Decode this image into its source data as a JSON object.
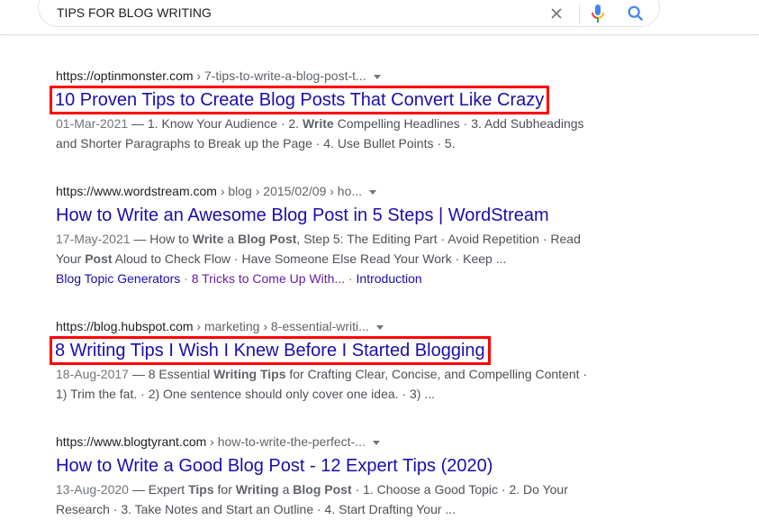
{
  "search": {
    "query": "TIPS FOR BLOG WRITING"
  },
  "icons": {
    "clear": "close-icon",
    "mic": "microphone-icon",
    "search": "search-icon"
  },
  "colors": {
    "link": "#1a0dab",
    "visited": "#681da8",
    "highlight_box": "#ff0000"
  },
  "results": [
    {
      "domain": "https://optinmonster.com",
      "crumbs": " › 7-tips-to-write-a-blog-post-t...",
      "title": "10 Proven Tips to Create Blog Posts That Convert Like Crazy",
      "highlighted": true,
      "date": "01-Mar-2021",
      "snippet": [
        {
          "t": " — 1. Know Your Audience · 2. "
        },
        {
          "t": "Write",
          "b": true
        },
        {
          "t": " Compelling Headlines · 3. Add Subheadings and Shorter Paragraphs to Break up the Page · 4. Use Bullet Points · 5."
        }
      ]
    },
    {
      "domain": "https://www.wordstream.com",
      "crumbs": " › blog › 2015/02/09 › ho...",
      "title": "How to Write an Awesome Blog Post in 5 Steps | WordStream",
      "highlighted": false,
      "date": "17-May-2021",
      "snippet": [
        {
          "t": " — How to "
        },
        {
          "t": "Write",
          "b": true
        },
        {
          "t": " a "
        },
        {
          "t": "Blog Post",
          "b": true
        },
        {
          "t": ", Step 5: The Editing Part · Avoid Repetition · Read Your "
        },
        {
          "t": "Post",
          "b": true
        },
        {
          "t": " Aloud to Check Flow · Have Someone Else Read Your Work · Keep ..."
        }
      ],
      "sitelinks": [
        {
          "label": "Blog Topic Generators",
          "visited": false
        },
        {
          "label": "8 Tricks to Come Up With...",
          "visited": true
        },
        {
          "label": "Introduction",
          "visited": false
        }
      ]
    },
    {
      "domain": "https://blog.hubspot.com",
      "crumbs": " › marketing › 8-essential-writi...",
      "title": "8 Writing Tips I Wish I Knew Before I Started Blogging",
      "highlighted": true,
      "date": "18-Aug-2017",
      "snippet": [
        {
          "t": " — 8 Essential "
        },
        {
          "t": "Writing Tips",
          "b": true
        },
        {
          "t": " for Crafting Clear, Concise, and Compelling Content · 1) Trim the fat. · 2) One sentence should only cover one idea. · 3) ..."
        }
      ]
    },
    {
      "domain": "https://www.blogtyrant.com",
      "crumbs": " › how-to-write-the-perfect-...",
      "title": "How to Write a Good Blog Post - 12 Expert Tips (2020)",
      "highlighted": false,
      "date": "13-Aug-2020",
      "snippet": [
        {
          "t": " — Expert "
        },
        {
          "t": "Tips",
          "b": true
        },
        {
          "t": " for "
        },
        {
          "t": "Writing",
          "b": true
        },
        {
          "t": " a "
        },
        {
          "t": "Blog Post",
          "b": true
        },
        {
          "t": " · 1. Choose a Good Topic · 2. Do Your Research · 3. Take Notes and Start an Outline · 4. Start Drafting Your ..."
        }
      ]
    }
  ]
}
